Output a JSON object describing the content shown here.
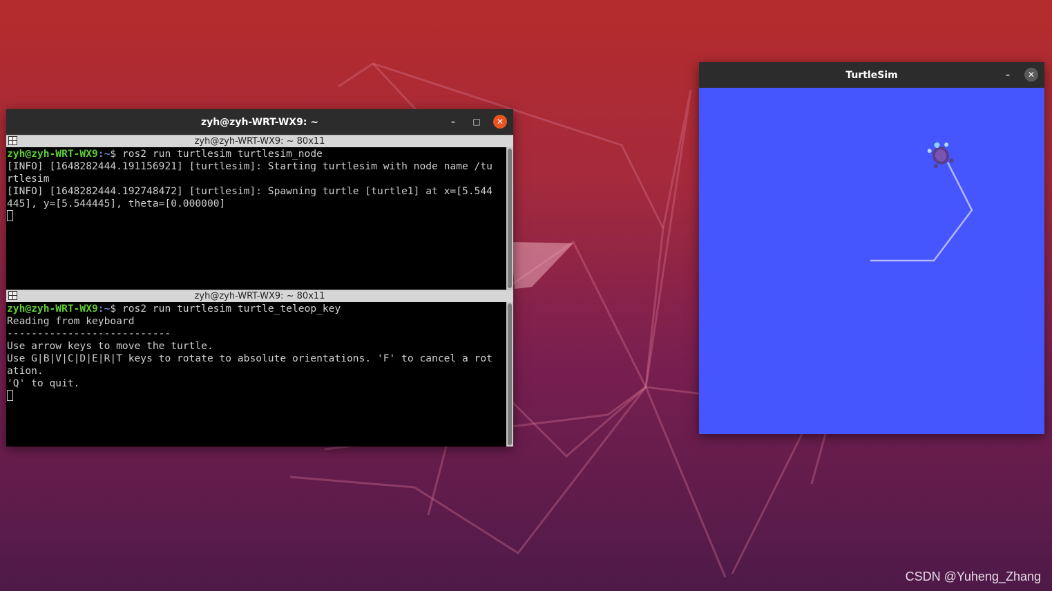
{
  "terminal": {
    "title": "zyh@zyh-WRT-WX9: ~",
    "panes": [
      {
        "header": "zyh@zyh-WRT-WX9: ~ 80x11",
        "prompt_user": "zyh@zyh-WRT-WX9",
        "prompt_path": ":~",
        "command": "$ ros2 run turtlesim turtlesim_node",
        "output": [
          "[INFO] [1648282444.191156921] [turtlesim]: Starting turtlesim with node name /tu",
          "rtlesim",
          "[INFO] [1648282444.192748472] [turtlesim]: Spawning turtle [turtle1] at x=[5.544",
          "445], y=[5.544445], theta=[0.000000]"
        ]
      },
      {
        "header": "zyh@zyh-WRT-WX9: ~ 80x11",
        "prompt_user": "zyh@zyh-WRT-WX9",
        "prompt_path": ":~",
        "command": "$ ros2 run turtlesim turtle_teleop_key",
        "output": [
          "Reading from keyboard",
          "---------------------------",
          "Use arrow keys to move the turtle.",
          "Use G|B|V|C|D|E|R|T keys to rotate to absolute orientations. 'F' to cancel a rot",
          "ation.",
          "'Q' to quit."
        ]
      }
    ],
    "controls": {
      "minimize": "–",
      "maximize": "□",
      "close": "✕"
    }
  },
  "turtlesim": {
    "title": "TurtleSim",
    "controls": {
      "minimize": "–",
      "close": "✕"
    },
    "background_color": "#4556ff",
    "path_color": "#b3b8ff"
  },
  "watermark": "CSDN @Yuheng_Zhang"
}
